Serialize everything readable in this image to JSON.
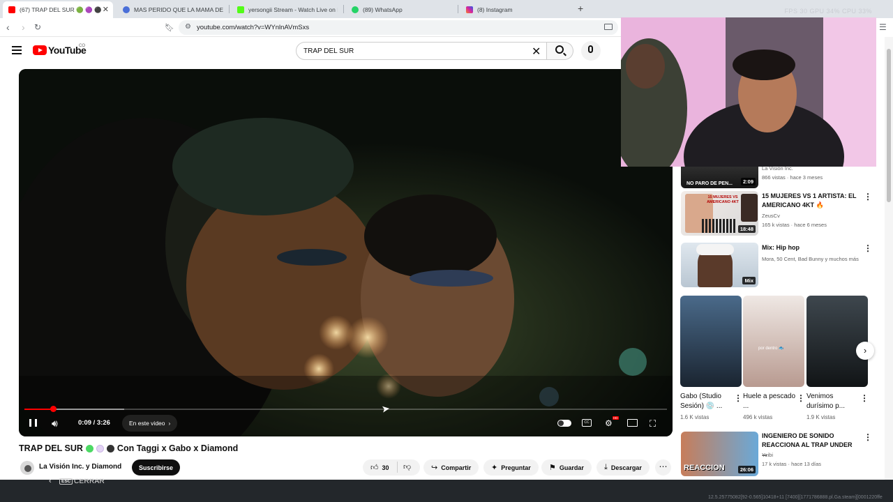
{
  "browser": {
    "tabs": [
      {
        "title": "(67) TRAP DEL SUR 🟢 🟣 ⚫",
        "favicon_color": "#ff0000",
        "active": true
      },
      {
        "title": "MAS PERIDO QUE LA MAMA DEL CH",
        "favicon_color": "#4a6fd8",
        "active": false
      },
      {
        "title": "yersongii Stream - Watch Live on Kick",
        "favicon_color": "#53fc18",
        "active": false
      },
      {
        "title": "(89) WhatsApp",
        "favicon_color": "#25d366",
        "active": false
      },
      {
        "title": "(8) Instagram",
        "favicon_color": "#d6249f",
        "active": false
      }
    ],
    "new_tab": "+",
    "stat_overlay": "FPS 30   GPU 34%   CPU 33%",
    "url": "youtube.com/watch?v=WYnlnAVmSxs"
  },
  "youtube": {
    "country_code": "CO",
    "search_query": "TRAP DEL SUR",
    "player": {
      "time_display": "0:09 / 3:26",
      "chapter_label": "En este video",
      "progress_fraction": 0.045,
      "buffer_fraction": 0.155
    },
    "video": {
      "title": "TRAP DEL SUR",
      "title_suffix": "Con Taggi x Gabo x Diamond",
      "emoji_colors": [
        "#4cd964",
        "#e3d3f4",
        "#333333"
      ]
    },
    "channel": {
      "name": "La Visión Inc. y Diamond",
      "subscribe_label": "Suscribirse"
    },
    "actions": {
      "like_count": "30",
      "share_label": "Compartir",
      "ask_label": "Preguntar",
      "save_label": "Guardar",
      "download_label": "Descargar"
    },
    "recommendations": [
      {
        "title": "",
        "channel": "La Visión Inc.",
        "meta": "866 vistas · hace 3 meses",
        "duration": "2:09",
        "thumb_text": "NO PARO DE PEN..."
      },
      {
        "title": "15 MUJERES VS 1 ARTISTA: EL AMERICANO 4KT 🔥",
        "channel": "ZeusCv",
        "meta": "165 k vistas · hace 6 meses",
        "duration": "18:48",
        "thumb_text": "15 MUJERES VS AMERICANO 4KT"
      },
      {
        "title": "Mix: Hip hop",
        "channel": "Mora, 50 Cent, Bad Bunny y muchos más",
        "meta": "",
        "duration": "Mix",
        "thumb_text": ""
      },
      {
        "title": "INGENIERO DE SONIDO REACCIONA AL TRAP UNDER ...",
        "channel": "Yeibi",
        "meta": "17 k vistas · hace 13 días",
        "duration": "26:06",
        "thumb_text": "REACCION"
      }
    ],
    "shorts": [
      {
        "title": "Gabo (Studio Sesión) 💿 ...",
        "views": "1.6 K vistas",
        "thumb_text": ""
      },
      {
        "title": "Huele a pescado ...",
        "views": "496 k vistas",
        "thumb_text": "por dentro 🐟"
      },
      {
        "title": "Venimos durísimo p...",
        "views": "1.9 K vistas",
        "thumb_text": ""
      }
    ]
  },
  "overlay": {
    "esc_key": "ESC",
    "close_hint": "CERRAR",
    "debug_text": "12.5.25775082[92-0.565]10418+11 [7400][1771786888.pl.Ga.steam][0001220ffe"
  },
  "colors": {
    "accent": "#ff0000",
    "text": "#0f0f0f",
    "muted": "#606060"
  }
}
